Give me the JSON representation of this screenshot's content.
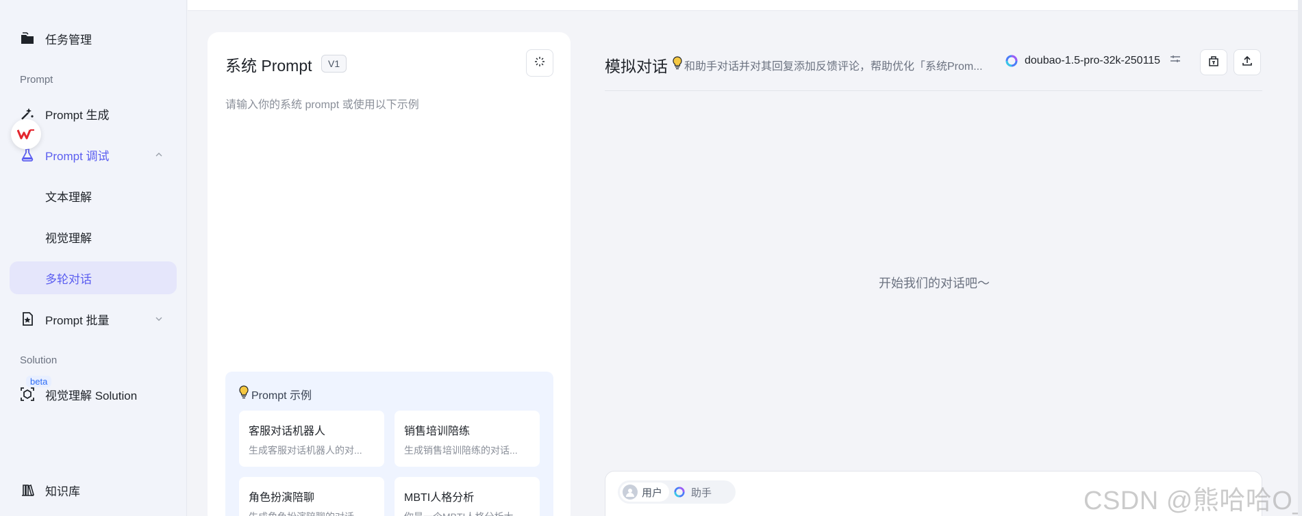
{
  "sidebar": {
    "task_management": "任务管理",
    "section_prompt": "Prompt",
    "prompt_generate": "Prompt 生成",
    "prompt_debug": "Prompt 调试",
    "text_understanding": "文本理解",
    "visual_understanding": "视觉理解",
    "multi_turn": "多轮对话",
    "prompt_batch": "Prompt 批量",
    "section_solution": "Solution",
    "beta": "beta",
    "visual_solution": "视觉理解 Solution",
    "knowledge_base": "知识库"
  },
  "system_prompt": {
    "title": "系统 Prompt",
    "version": "V1",
    "placeholder": "请输入你的系统 prompt 或使用以下示例",
    "examples_title": "Prompt 示例",
    "examples": [
      {
        "title": "客服对话机器人",
        "desc": "生成客服对话机器人的对..."
      },
      {
        "title": "销售培训陪练",
        "desc": "生成销售培训陪练的对话..."
      },
      {
        "title": "角色扮演陪聊",
        "desc": "生成角色扮演陪聊的对话..."
      },
      {
        "title": "MBTI人格分析",
        "desc": "你是一个MBTI人格分析大..."
      }
    ]
  },
  "chat": {
    "title": "模拟对话",
    "hint": "和助手对话并对其回复添加反馈评论，帮助优化「系统Prom...",
    "model": "doubao-1.5-pro-32k-250115",
    "empty": "开始我们的对话吧～",
    "role_user": "用户",
    "role_assistant": "助手"
  },
  "watermark": "CSDN @熊哈哈O_o",
  "colors": {
    "accent": "#5b5ef0",
    "selected_bg": "#e5e6fb",
    "sidebar_bg": "#f2f4fa",
    "examples_bg": "#eff4ff"
  }
}
